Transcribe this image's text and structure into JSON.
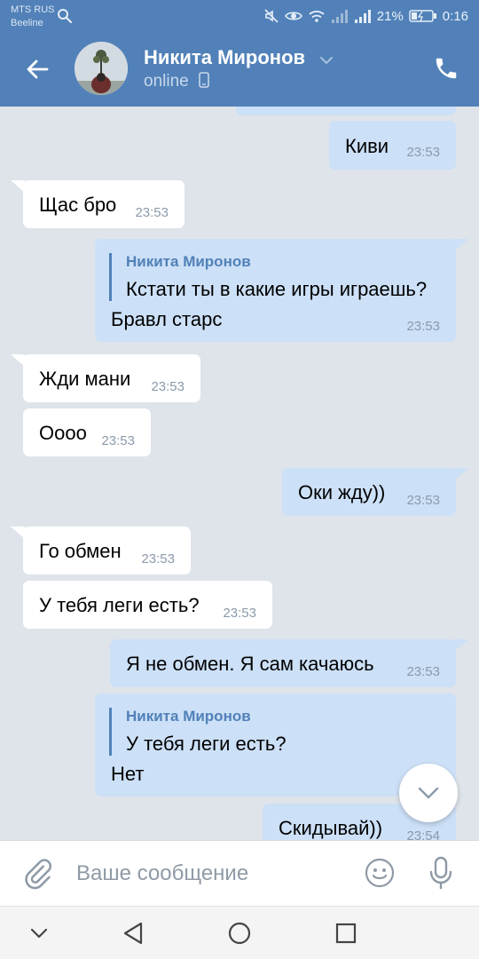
{
  "status_bar": {
    "operator_1": "MTS RUS",
    "operator_2": "Beeline",
    "battery": "21%",
    "time": "0:16"
  },
  "header": {
    "contact_name": "Никита Миронов",
    "contact_status": "online",
    "icons": [
      "back-arrow-icon",
      "chevron-down-icon",
      "phone-icon",
      "mobile-device-icon"
    ]
  },
  "messages": [
    {
      "dir": "out",
      "text": "Киви",
      "time": "23:53"
    },
    {
      "dir": "in",
      "text": "Щас бро",
      "time": "23:53"
    },
    {
      "dir": "out",
      "quote_author": "Никита Миронов",
      "quote_text": "Кстати ты в какие игры играешь?",
      "text": "Бравл старс",
      "time": "23:53"
    },
    {
      "dir": "in",
      "text": "Жди мани",
      "time": "23:53"
    },
    {
      "dir": "in",
      "text": "Оооо",
      "time": "23:53"
    },
    {
      "dir": "out",
      "text": "Оки жду))",
      "time": "23:53"
    },
    {
      "dir": "in",
      "text": "Го обмен",
      "time": "23:53"
    },
    {
      "dir": "in",
      "text": "У тебя леги есть?",
      "time": "23:53"
    },
    {
      "dir": "out",
      "text": "Я не обмен. Я сам качаюсь",
      "time": "23:53"
    },
    {
      "dir": "out",
      "quote_author": "Никита Миронов",
      "quote_text": "У тебя леги есть?",
      "text": "Нет",
      "time": ""
    },
    {
      "dir": "out",
      "text": "Скидывай))",
      "time": "23:54"
    }
  ],
  "composer": {
    "placeholder": "Ваше сообщение",
    "icons": [
      "paperclip-icon",
      "emoji-icon",
      "microphone-icon"
    ]
  },
  "colors": {
    "header_bg": "#5181b8",
    "outgoing_bubble": "#cce0f7",
    "incoming_bubble": "#ffffff",
    "chat_bg": "#dfe4ea"
  }
}
